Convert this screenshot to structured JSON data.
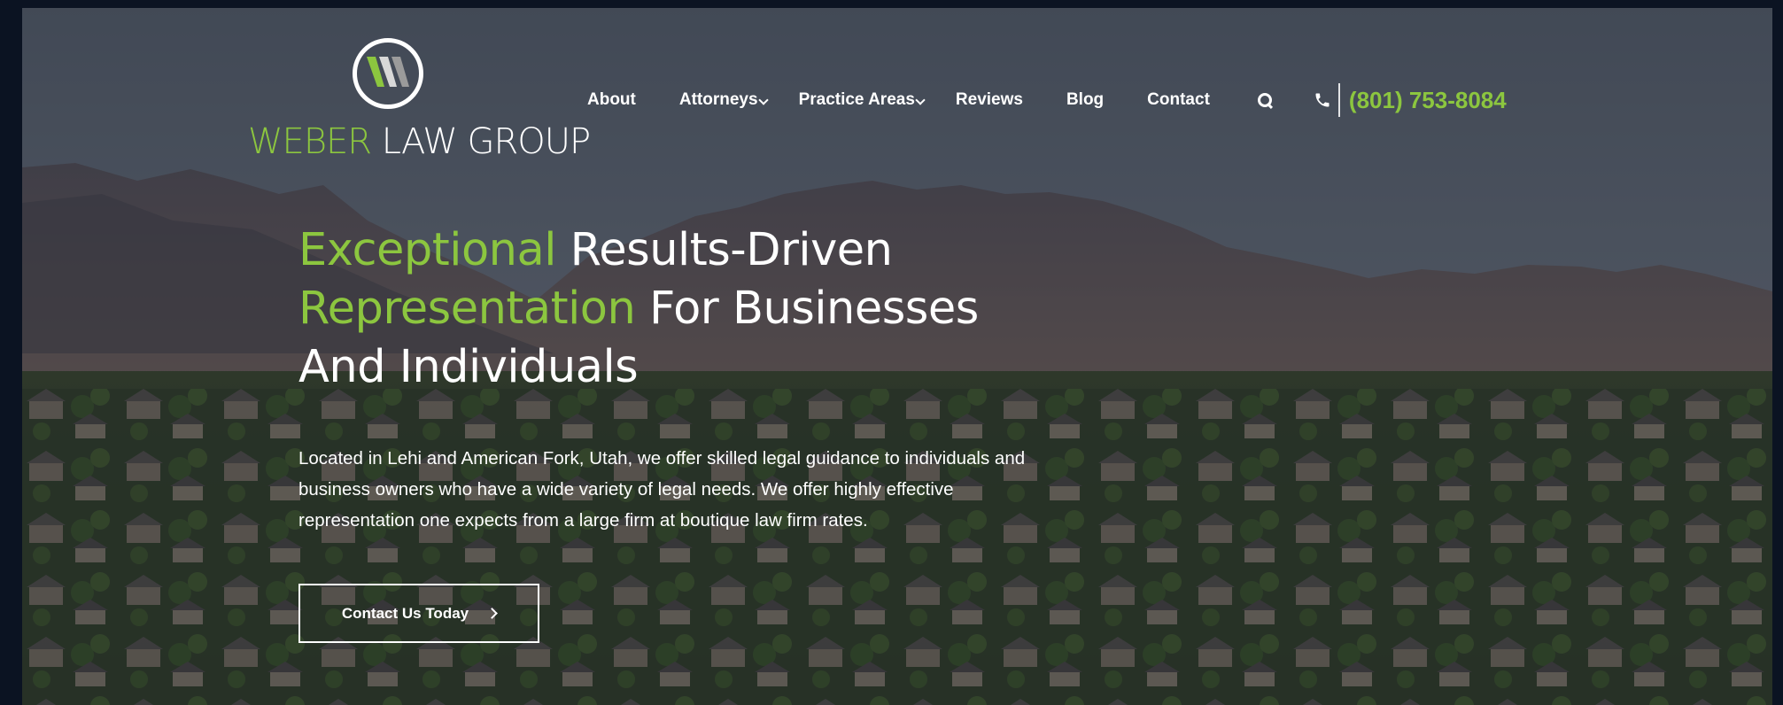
{
  "brand": {
    "logo_word_green": "WEBER",
    "logo_word_white": " LAW GROUP"
  },
  "nav": {
    "items": [
      {
        "label": "About"
      },
      {
        "label": "Attorneys"
      },
      {
        "label": "Practice Areas"
      },
      {
        "label": "Reviews"
      },
      {
        "label": "Blog"
      },
      {
        "label": "Contact"
      }
    ],
    "phone": "(801) 753-8084"
  },
  "hero": {
    "headline_line1_green": "Exceptional",
    "headline_line1_white": " Results-Driven",
    "headline_line2_green": "Representation",
    "headline_line2_white": " For Businesses",
    "headline_line3": "And Individuals",
    "intro": "Located in Lehi and American Fork, Utah, we offer skilled legal guidance to individuals and business owners who have a wide variety of legal needs. We offer highly effective representation one expects from a large firm at boutique law firm rates.",
    "cta_label": "Contact Us Today"
  },
  "colors": {
    "accent": "#8cc63f",
    "text": "#ffffff",
    "frame": "#0b1322"
  }
}
